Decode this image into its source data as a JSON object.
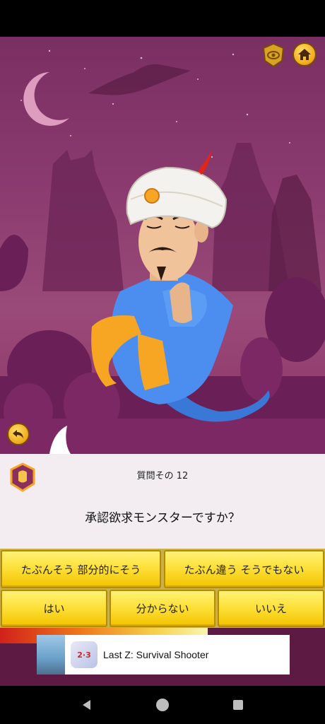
{
  "question": {
    "number_label": "質問その 12",
    "text": "承認欲求モンスターですか？"
  },
  "answers": {
    "probably": "たぶんそう 部分的にそう",
    "probably_not": "たぶん違う そうでもない",
    "yes": "はい",
    "dont_know": "分からない",
    "no": "いいえ"
  },
  "progress": {
    "fraction": 0.64
  },
  "ad": {
    "title": "Last Z: Survival Shooter",
    "logo_text": "2·3"
  },
  "icons": {
    "home": "home-icon",
    "badge": "award-badge-icon",
    "back": "undo-arrow-icon",
    "question": "shield-badge-icon"
  },
  "colors": {
    "scene_bg": "#8a3a6e",
    "answer_yellow": "#fde13a",
    "panel_bg": "#f3edf1",
    "strip_bg": "#5d1a42"
  }
}
